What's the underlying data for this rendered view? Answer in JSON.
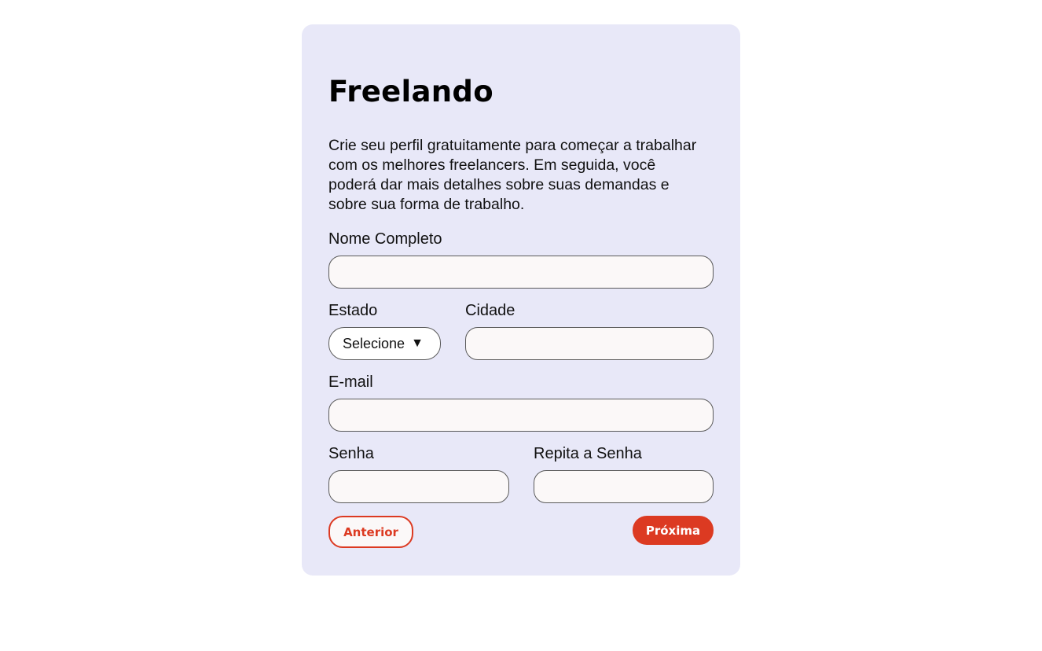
{
  "form": {
    "title": "Freelando",
    "description": "Crie seu perfil gratuitamente para começar a trabalhar com os melhores freelancers. Em seguida, você poderá dar mais detalhes sobre suas demandas e sobre sua forma de trabalho.",
    "fields": {
      "full_name": {
        "label": "Nome Completo",
        "value": "",
        "placeholder": ""
      },
      "state": {
        "label": "Estado",
        "selected": "Selecione",
        "caret": "▼"
      },
      "city": {
        "label": "Cidade",
        "value": "",
        "placeholder": ""
      },
      "email": {
        "label": "E-mail",
        "value": "",
        "placeholder": ""
      },
      "password": {
        "label": "Senha",
        "value": "",
        "placeholder": ""
      },
      "repeat_password": {
        "label": "Repita a Senha",
        "value": "",
        "placeholder": ""
      }
    },
    "buttons": {
      "previous": "Anterior",
      "next": "Próxima"
    }
  },
  "colors": {
    "page_background": "#ffffff",
    "card_background": "#e8e8f8",
    "input_background": "#fbf8f8",
    "accent": "#dc3a22"
  }
}
